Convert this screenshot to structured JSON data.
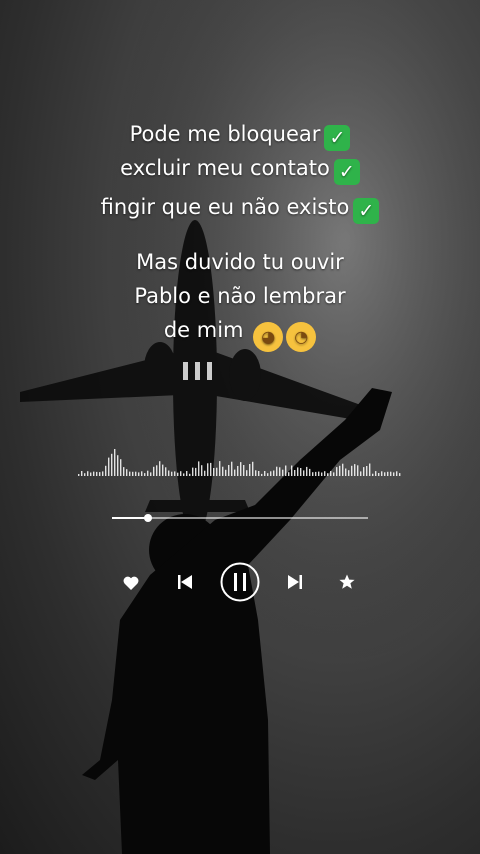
{
  "caption": {
    "line1": "Pode me bloquear",
    "line2": "excluir meu contato",
    "line3": "fingir que eu não existo",
    "line4": "Mas duvido tu  ouvir",
    "line5": "Pablo e não lembrar",
    "line6": "de mim"
  },
  "icons": {
    "check": "✓",
    "emoji_hand_over_mouth": "face-with-hand-over-mouth",
    "emoji_zany": "zany-face"
  },
  "player": {
    "progress": 0.14,
    "controls": [
      "heart-icon",
      "previous-icon",
      "pause-icon",
      "next-icon",
      "star-icon"
    ]
  },
  "colors": {
    "check_green": "#2fb34a",
    "emoji_yellow": "#f6c23e",
    "ui_white": "#ffffff"
  }
}
